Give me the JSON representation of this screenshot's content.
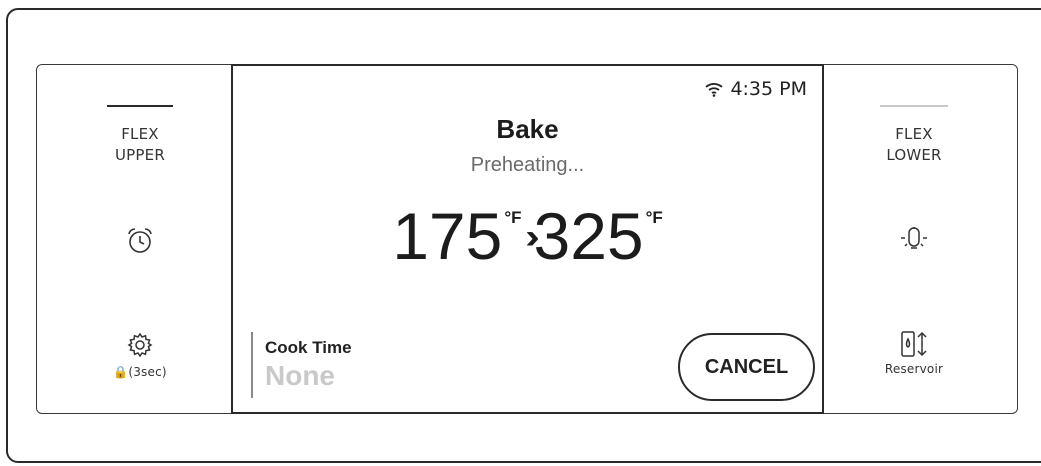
{
  "left_panel": {
    "flex_upper_line1": "FLEX",
    "flex_upper_line2": "UPPER",
    "lock_label": "🔒(3sec)"
  },
  "right_panel": {
    "flex_lower_line1": "FLEX",
    "flex_lower_line2": "LOWER",
    "reservoir_label": "Reservoir"
  },
  "display": {
    "time": "4:35 PM",
    "mode": "Bake",
    "status": "Preheating...",
    "current_temp": "175",
    "target_temp": "325",
    "temp_unit": "°F",
    "arrow_glyph": "›››",
    "cook_time_label": "Cook Time",
    "cook_time_value": "None",
    "cancel_label": "CANCEL"
  },
  "colors": {
    "upper_indicator": "#2a2a2a",
    "lower_indicator": "#c8c8c8"
  },
  "icons": {
    "wifi": "wifi-icon",
    "timer": "alarm-clock-icon",
    "settings": "gear-icon",
    "light": "light-bulb-icon",
    "reservoir": "water-reservoir-icon"
  }
}
